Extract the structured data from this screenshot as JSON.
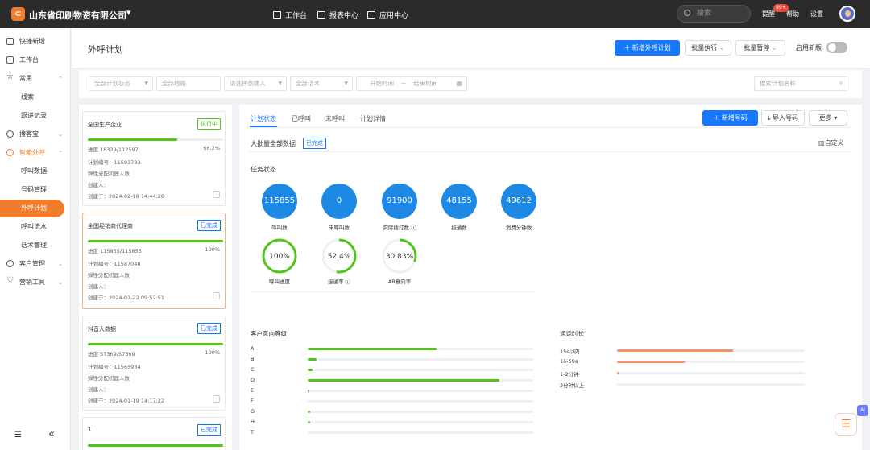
{
  "topbar": {
    "company": "山东省印刷物资有限公司",
    "nav": [
      "工作台",
      "报表中心",
      "应用中心"
    ],
    "search_placeholder": "搜索",
    "badge": "99+",
    "items": [
      "提醒",
      "帮助",
      "设置"
    ]
  },
  "sidebar": {
    "items": [
      {
        "label": "快捷新增",
        "icon": "add-doc-icon"
      },
      {
        "label": "工作台",
        "icon": "monitor-icon"
      },
      {
        "label": "常用",
        "icon": "star-icon"
      },
      {
        "label": "线索",
        "icon": ""
      },
      {
        "label": "跟进记录",
        "icon": ""
      },
      {
        "label": "搜客宝",
        "icon": "search-bag-icon"
      },
      {
        "label": "智能外呼",
        "icon": "phone-icon"
      },
      {
        "label": "呼叫数据",
        "icon": ""
      },
      {
        "label": "号码管理",
        "icon": ""
      },
      {
        "label": "外呼计划",
        "icon": ""
      },
      {
        "label": "呼叫流水",
        "icon": ""
      },
      {
        "label": "话术管理",
        "icon": ""
      },
      {
        "label": "客户管理",
        "icon": "users-icon"
      },
      {
        "label": "营销工具",
        "icon": "heart-icon"
      }
    ],
    "collapse_icon": "«"
  },
  "header": {
    "title": "外呼计划",
    "new_plan": "新增外呼计划",
    "batch_exec": "批量执行",
    "batch_pause": "批量暂停",
    "new_version": "启用新版"
  },
  "filters": {
    "status": "全部计划状态",
    "line": "全部线路",
    "creator": "请选择创建人",
    "script": "全部话术",
    "start": "开始时间",
    "tilde": "~",
    "end": "结束时间",
    "search": "搜索计划名称"
  },
  "plans": [
    {
      "title": "全国生产企业",
      "tag": "执行中",
      "tag_type": "run",
      "progress_text": "进度 18339/112597",
      "pct": "66.2%",
      "progress": 0.66,
      "plan_no": "计划编号：11593733",
      "robots": "弹性分配机器人数",
      "creator": "创建人：",
      "created": "创建于：2024-02-18 14:44:28"
    },
    {
      "title": "全国经销商代理商",
      "tag": "已完成",
      "tag_type": "done",
      "progress_text": "进度 115855/115855",
      "pct": "100%",
      "progress": 1.0,
      "plan_no": "计划编号：11587048",
      "robots": "弹性分配机器人数",
      "creator": "创建人：",
      "created": "创建于：2024-01-22 09:52:51"
    },
    {
      "title": "抖音大数据",
      "tag": "已完成",
      "tag_type": "done",
      "progress_text": "进度 57369/57369",
      "pct": "100%",
      "progress": 1.0,
      "plan_no": "计划编号：11565984",
      "robots": "弹性分配机器人数",
      "creator": "创建人：",
      "created": "创建于：2024-01-19 14:17:22"
    },
    {
      "title": "1",
      "tag": "已完成",
      "tag_type": "done",
      "progress": 1.0
    }
  ],
  "main": {
    "tabs": [
      "计划状态",
      "已呼叫",
      "未呼叫",
      "计划详情"
    ],
    "new_number": "新增号码",
    "import_number": "导入号码",
    "more": "更多",
    "plan_name": "大批量全部数据",
    "plan_tag": "已完成",
    "custom": "自定义",
    "section_status": "任务状态",
    "circles": [
      {
        "value": "115855",
        "label": "呼叫数"
      },
      {
        "value": "0",
        "label": "未呼叫数"
      },
      {
        "value": "91900",
        "label": "实际拨打数"
      },
      {
        "value": "48155",
        "label": "接通数"
      },
      {
        "value": "49612",
        "label": "消费分钟数"
      }
    ],
    "rings": [
      {
        "value": "100%",
        "label": "呼叫进度",
        "fraction": 1.0,
        "color": "#52c41a"
      },
      {
        "value": "52.4%",
        "label": "接通率",
        "fraction": 0.524,
        "color": "#52c41a"
      },
      {
        "value": "30.83%",
        "label": "AB意向率",
        "fraction": 0.3083,
        "color": "#52c41a"
      }
    ],
    "intent_title": "客户意向等级",
    "intent": [
      {
        "label": "A",
        "v": 0.57
      },
      {
        "label": "B",
        "v": 0.04
      },
      {
        "label": "C",
        "v": 0.02
      },
      {
        "label": "D",
        "v": 0.85
      },
      {
        "label": "E",
        "v": 0.005
      },
      {
        "label": "F",
        "v": 0
      },
      {
        "label": "G",
        "v": 0.01
      },
      {
        "label": "H",
        "v": 0.01
      },
      {
        "label": "T",
        "v": 0
      }
    ],
    "duration_title": "通话时长",
    "duration": [
      {
        "label": "15s以内",
        "v": 0.62
      },
      {
        "label": "16-59s",
        "v": 0.36
      },
      {
        "label": "1-2分钟",
        "v": 0.01
      },
      {
        "label": "2分钟以上",
        "v": 0
      }
    ],
    "colors": {
      "intent": "#52c41a",
      "duration": "#f0956a",
      "primary": "#1677ff",
      "accent": "#f07c2c"
    }
  }
}
